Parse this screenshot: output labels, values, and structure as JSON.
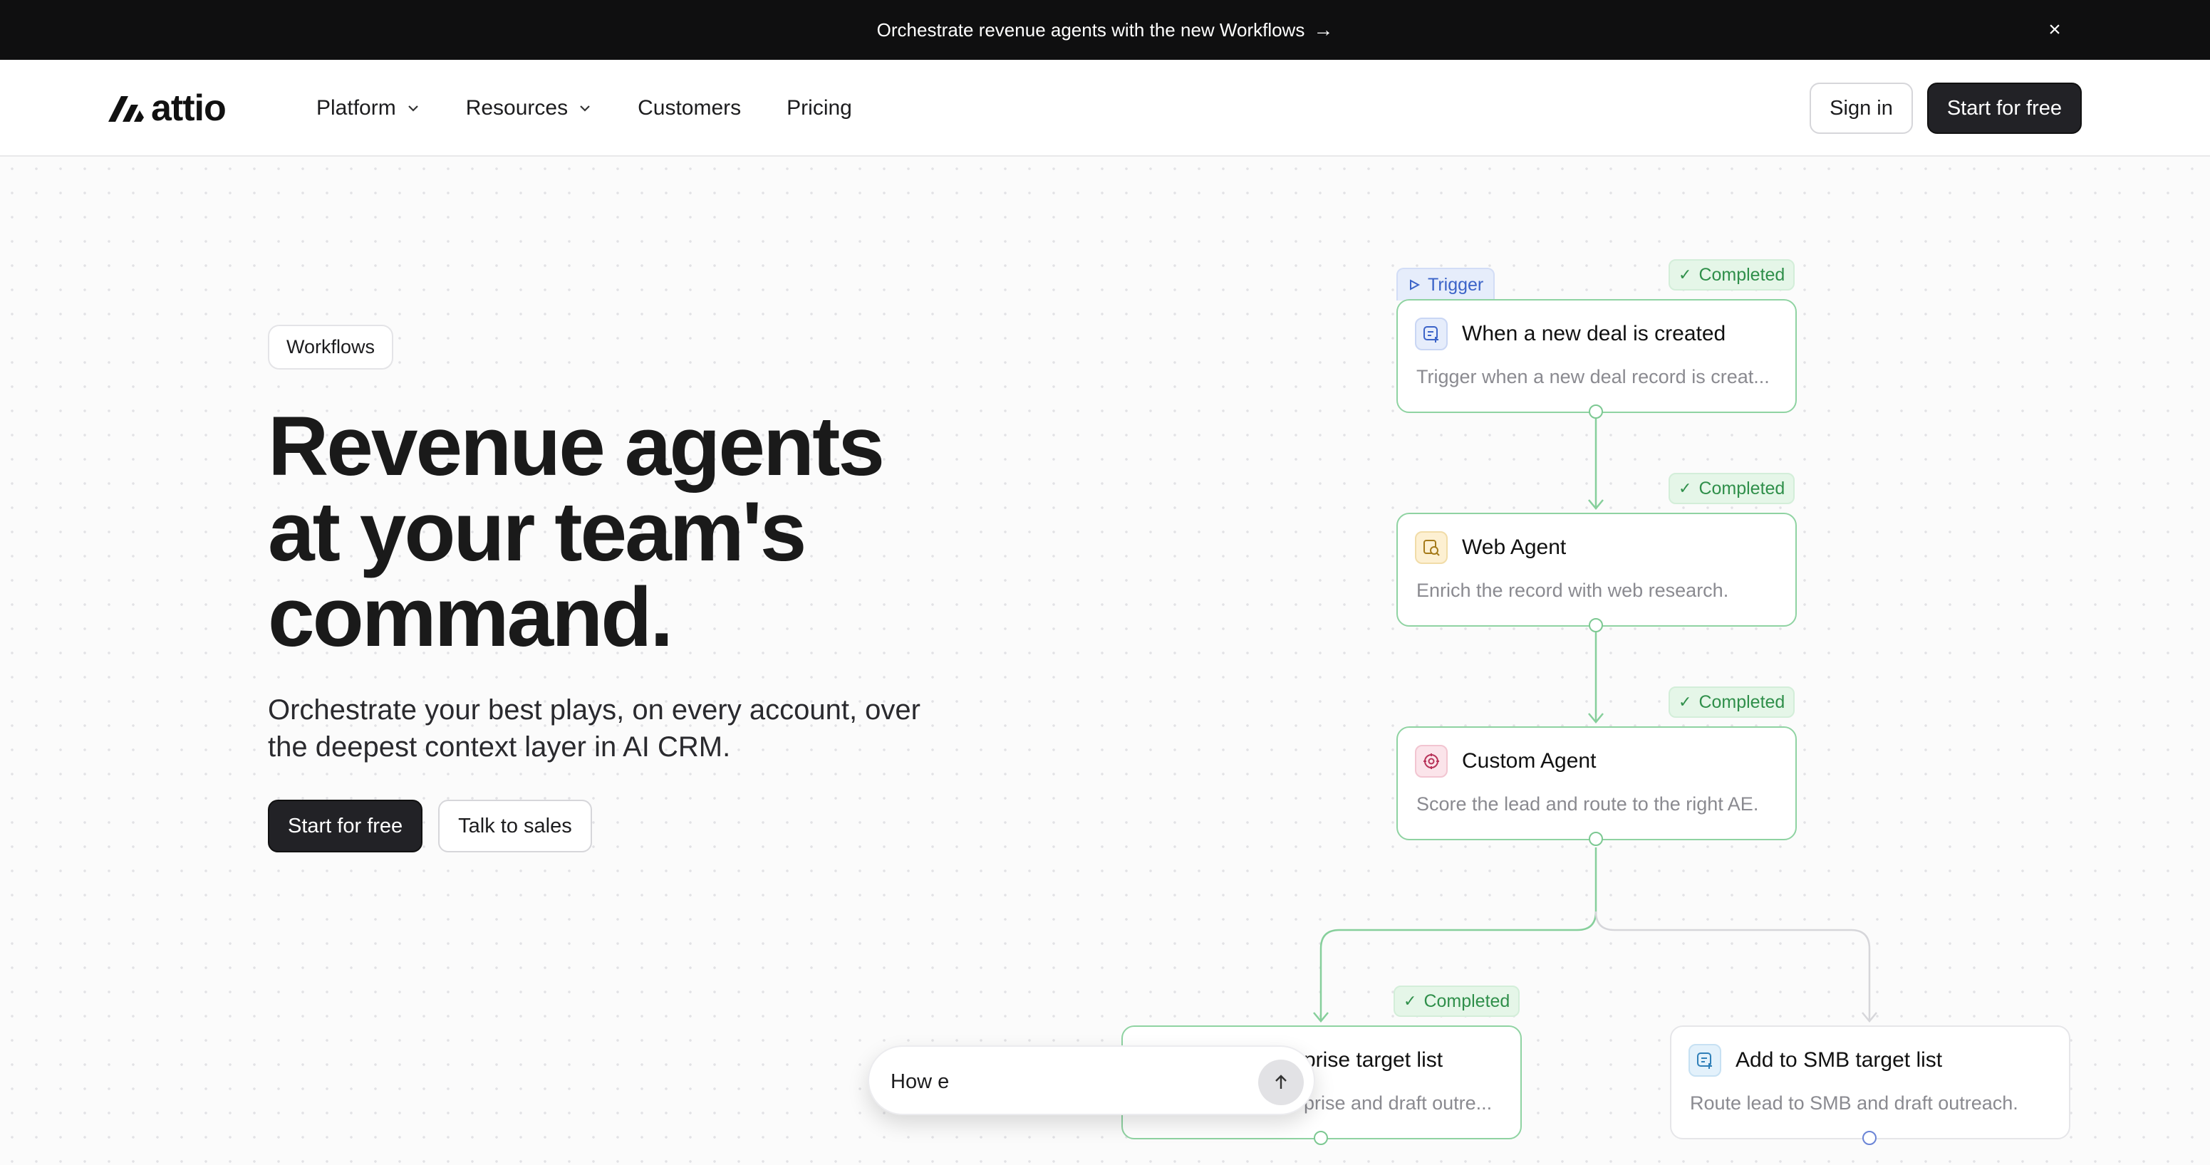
{
  "announcement": {
    "text": "Orchestrate revenue agents with the new Workflows",
    "arrow": "→",
    "close": "×"
  },
  "nav": {
    "logo_text": "attio",
    "links": [
      {
        "label": "Platform"
      },
      {
        "label": "Resources"
      },
      {
        "label": "Customers"
      },
      {
        "label": "Pricing"
      }
    ],
    "sign_in": "Sign in",
    "start_free": "Start for free"
  },
  "hero": {
    "pill": "Workflows",
    "headline": "Revenue agents at your team's command.",
    "subheadline": "Orchestrate your best plays, on every account, over the deepest context layer in AI CRM.",
    "cta_primary": "Start for free",
    "cta_secondary": "Talk to sales"
  },
  "workflow": {
    "trigger_tag": "Trigger",
    "completed_label": "Completed",
    "nodes": [
      {
        "title": "When a new deal is created",
        "desc": "Trigger when a new deal record is creat..."
      },
      {
        "title": "Web Agent",
        "desc": "Enrich the record with web research."
      },
      {
        "title": "Custom Agent",
        "desc": "Score the lead and route to the right AE."
      },
      {
        "title": "prise target list",
        "desc": "prise and draft outre..."
      },
      {
        "title": "Add to SMB target list",
        "desc": "Route lead to SMB and draft outreach."
      }
    ]
  },
  "chat": {
    "value": "How e"
  },
  "colors": {
    "accent_green": "#8fd3a2",
    "badge_green": "#2f8f4a",
    "trigger_blue": "#3b63c8",
    "dark": "#222226"
  }
}
